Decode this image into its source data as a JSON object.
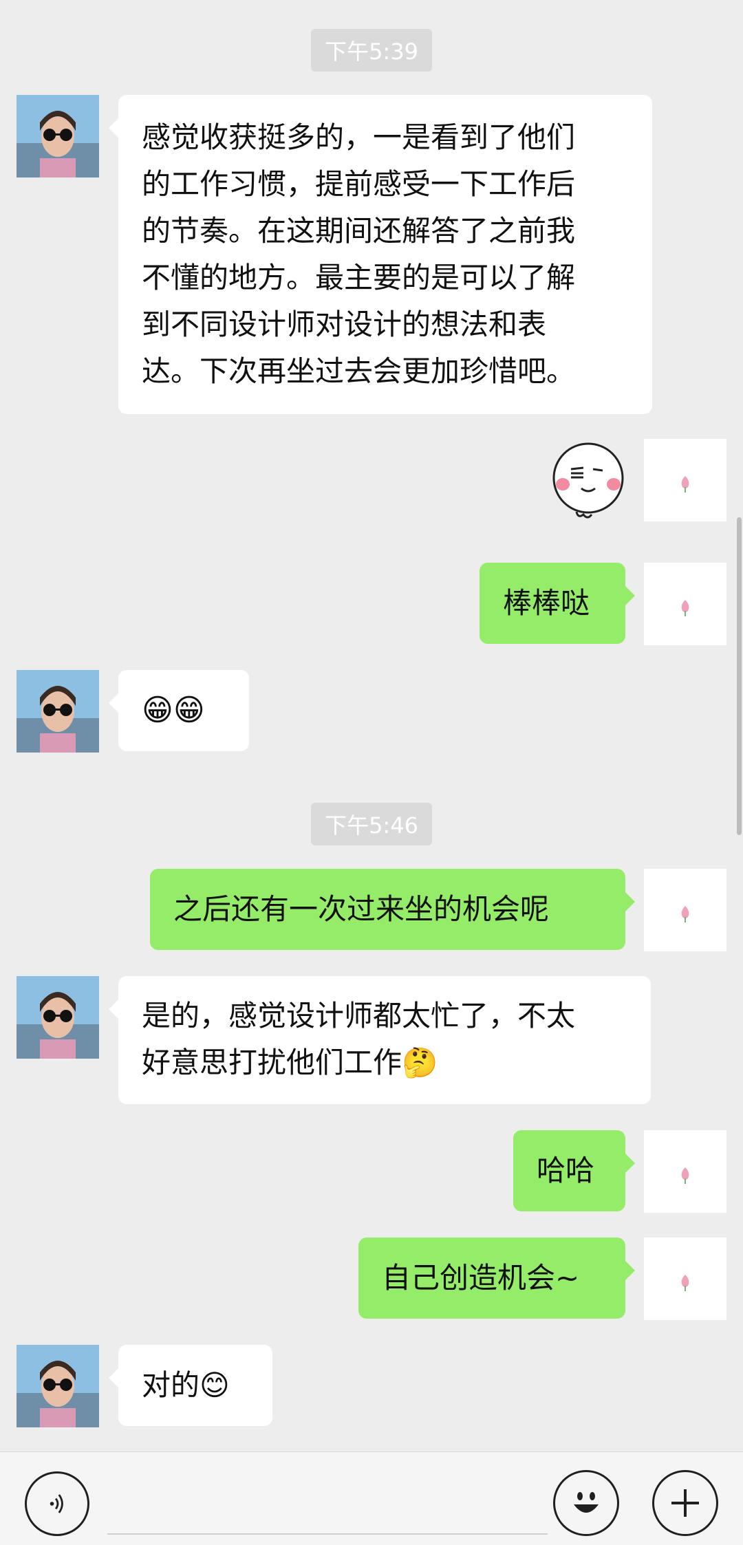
{
  "timestamps": [
    "下午5:39",
    "下午5:46"
  ],
  "messages": [
    {
      "side": "left",
      "text": "感觉收获挺多的，一是看到了他们\n的工作习惯，提前感受一下工作后\n的节奏。在这期间还解答了之前我\n不懂的地方。最主要的是可以了解\n到不同设计师对设计的想法和表\n达。下次再坐过去会更加珍惜吧。"
    },
    {
      "side": "right",
      "text": "棒棒哒"
    },
    {
      "side": "left",
      "text": "😁😁"
    },
    {
      "side": "right",
      "text": "之后还有一次过来坐的机会呢"
    },
    {
      "side": "left",
      "text": "是的，感觉设计师都太忙了，不太\n好意思打扰他们工作🤔"
    },
    {
      "side": "right",
      "text": "哈哈"
    },
    {
      "side": "right",
      "text": "自己创造机会~"
    },
    {
      "side": "left",
      "text": "对的😊"
    }
  ],
  "icons": {
    "voice": "voice-icon",
    "emoji": "emoji-icon",
    "more": "plus-icon"
  },
  "colors": {
    "background": "#ededed",
    "sent_bubble": "#95ec69",
    "received_bubble": "#ffffff",
    "timestamp_bg": "#dadada"
  }
}
